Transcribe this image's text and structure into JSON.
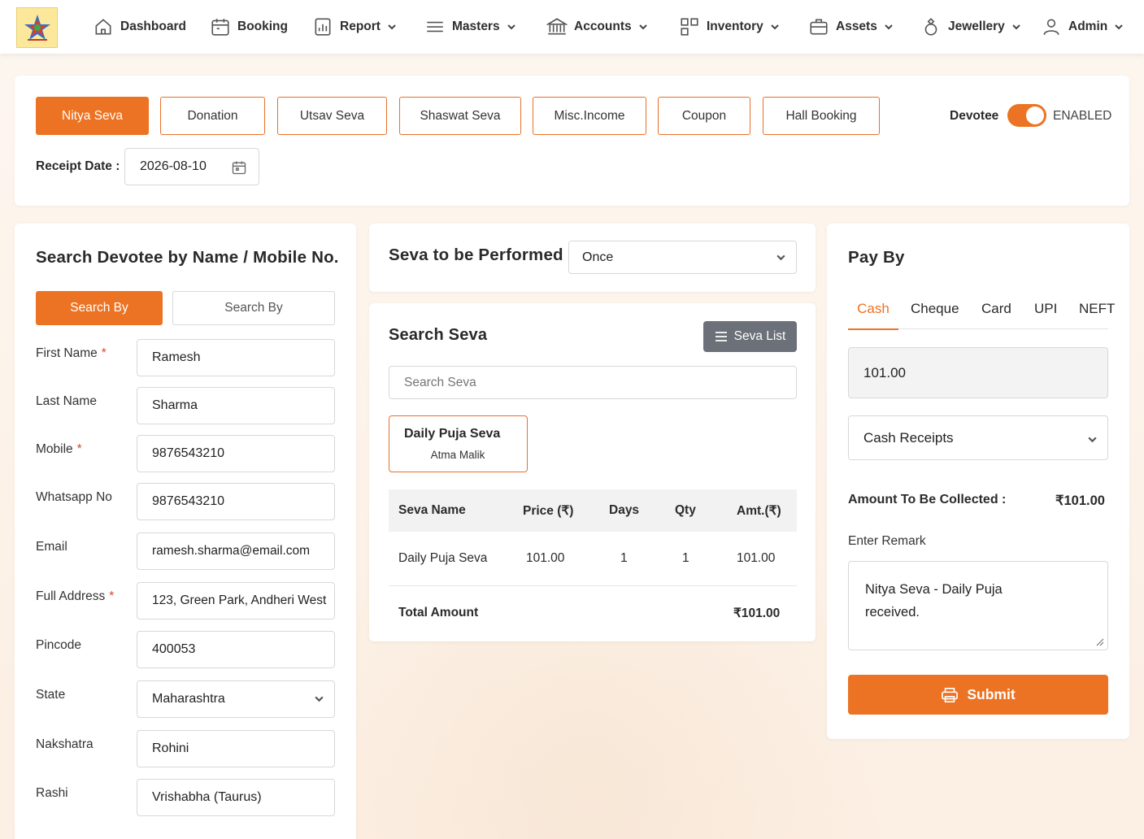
{
  "nav": {
    "items": [
      {
        "label": "Dashboard",
        "icon": "home-icon",
        "dropdown": false
      },
      {
        "label": "Booking",
        "icon": "calendar-icon",
        "dropdown": false
      },
      {
        "label": "Report",
        "icon": "report-icon",
        "dropdown": true
      },
      {
        "label": "Masters",
        "icon": "menu-lines-icon",
        "dropdown": true
      },
      {
        "label": "Accounts",
        "icon": "bank-icon",
        "dropdown": true
      },
      {
        "label": "Inventory",
        "icon": "grid-icon",
        "dropdown": true
      },
      {
        "label": "Assets",
        "icon": "briefcase-icon",
        "dropdown": true
      },
      {
        "label": "Jewellery",
        "icon": "ring-icon",
        "dropdown": true
      },
      {
        "label": "Admin",
        "icon": "user-icon",
        "dropdown": true
      }
    ]
  },
  "top": {
    "tabs": [
      "Nitya Seva",
      "Donation",
      "Utsav Seva",
      "Shaswat Seva",
      "Misc.Income",
      "Coupon",
      "Hall Booking"
    ],
    "active_tab": "Nitya Seva",
    "devotee_label": "Devotee",
    "toggle_state": "ENABLED",
    "receipt_date_label": "Receipt Date :",
    "receipt_date": "2026-08-10"
  },
  "devotee": {
    "title": "Search Devotee by Name / Mobile No.",
    "search_by_active": "Search By",
    "search_by_inactive": "Search By",
    "fields": [
      {
        "label": "First Name",
        "required": true,
        "value": "Ramesh"
      },
      {
        "label": "Last Name",
        "required": false,
        "value": "Sharma"
      },
      {
        "label": "Mobile",
        "required": true,
        "value": "9876543210"
      },
      {
        "label": "Whatsapp No",
        "required": false,
        "value": "9876543210"
      },
      {
        "label": "Email",
        "required": false,
        "value": "ramesh.sharma@email.com"
      },
      {
        "label": "Full Address",
        "required": true,
        "value": "123, Green Park, Andheri West"
      },
      {
        "label": "Pincode",
        "required": false,
        "value": "400053"
      },
      {
        "label": "State",
        "required": false,
        "value": "Maharashtra",
        "select": true
      },
      {
        "label": "Nakshatra",
        "required": false,
        "value": "Rohini"
      },
      {
        "label": "Rashi",
        "required": false,
        "value": "Vrishabha (Taurus)"
      }
    ]
  },
  "seva": {
    "perform_label": "Seva to be Performed",
    "perform_value": "Once",
    "search_title": "Search Seva",
    "list_button": "Seva List",
    "search_placeholder": "Search Seva",
    "selected_card": {
      "name": "Daily Puja Seva",
      "sub": "Atma Malik"
    },
    "table": {
      "headers": [
        "Seva Name",
        "Price (₹)",
        "Days",
        "Qty",
        "Amt.(₹)"
      ],
      "rows": [
        [
          "Daily Puja Seva",
          "101.00",
          "1",
          "1",
          "101.00"
        ]
      ],
      "total_label": "Total Amount",
      "total_value": "₹101.00"
    }
  },
  "pay": {
    "title": "Pay By",
    "tabs": [
      "Cash",
      "Cheque",
      "Card",
      "UPI",
      "NEFT"
    ],
    "active_tab": "Cash",
    "amount": "101.00",
    "account": "Cash Receipts",
    "collect_label": "Amount To Be Collected :",
    "collect_value": "₹101.00",
    "remark_label": "Enter Remark",
    "remark_line1": "Nitya Seva - Daily Puja",
    "remark_line2": "received.",
    "submit": "Submit"
  },
  "colors": {
    "accent": "#ec7323",
    "dark_button": "#6b7079",
    "page_bg": "#fdf3ea"
  }
}
